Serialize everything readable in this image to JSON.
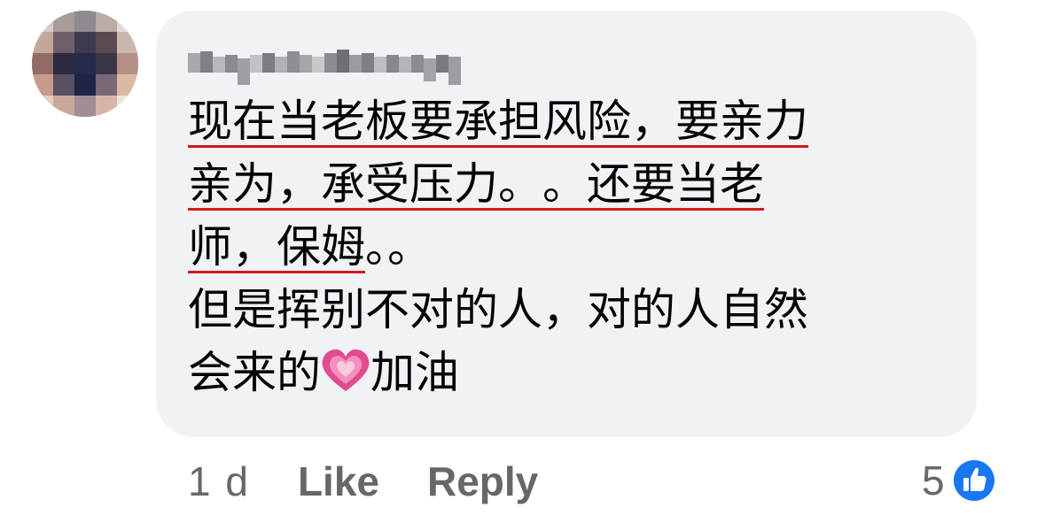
{
  "comment": {
    "author_name": "",
    "text_lines": {
      "l1": "现在当老板要承担风险，要亲力",
      "l2a": "亲为，承受压力。",
      "l2b": "。还要当老",
      "l3a": "师，保姆",
      "l3b": "。。",
      "l4": "但是挥别不对的人，对的人自然",
      "l5a": "会来的",
      "l5b": "加油"
    },
    "emoji": "growing-heart-icon"
  },
  "actions": {
    "timestamp": "1 d",
    "like_label": "Like",
    "reply_label": "Reply"
  },
  "reactions": {
    "count": "5",
    "icon": "like-icon"
  },
  "colors": {
    "bubble_bg": "#f0f2f5",
    "text": "#050505",
    "secondary": "#65676b",
    "underline": "#d21a1a",
    "like_blue": "#1877f2"
  }
}
